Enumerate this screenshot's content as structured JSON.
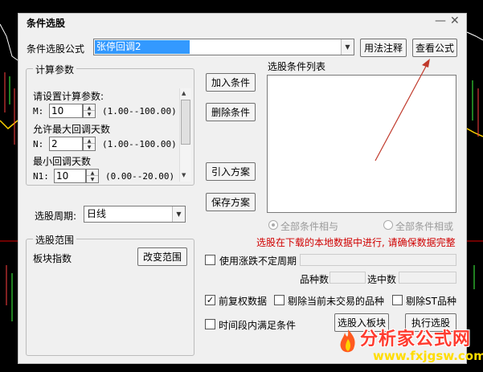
{
  "window": {
    "title": "条件选股"
  },
  "formula": {
    "label": "条件选股公式",
    "value": "张停回调2",
    "usage_button": "用法注释",
    "view_button": "查看公式"
  },
  "params": {
    "legend": "计算参数",
    "prompt": "请设置计算参数:",
    "items": [
      {
        "desc": "",
        "name": "M:",
        "value": "10",
        "range": "(1.00--100.00)"
      },
      {
        "desc": "允许最大回调天数",
        "name": "N:",
        "value": "2",
        "range": "(1.00--100.00)"
      },
      {
        "desc": "最小回调天数",
        "name": "N1:",
        "value": "10",
        "range": "(0.00--20.00)"
      }
    ]
  },
  "period": {
    "label": "选股周期:",
    "value": "日线"
  },
  "actions": {
    "add": "加入条件",
    "delete": "删除条件",
    "import": "引入方案",
    "save": "保存方案"
  },
  "condition_list": {
    "label": "选股条件列表"
  },
  "logic": {
    "all_and": "全部条件相与",
    "all_or": "全部条件相或"
  },
  "notice": "选股在下载的本地数据中进行, 请确保数据完整",
  "range": {
    "legend": "选股范围",
    "value": "板块指数",
    "change_button": "改变范围"
  },
  "options": {
    "uncertain_period": "使用涨跌不定周期",
    "count_label": "品种数",
    "selected_label": "选中数",
    "forward_adjust": "前复权数据",
    "exclude_non_trading": "剔除当前未交易的品种",
    "exclude_st": "剔除ST品种",
    "time_range": "时间段内满足条件",
    "to_block_button": "选股入板块",
    "execute_button": "执行选股"
  },
  "watermark": {
    "title": "分析家公式网",
    "url": "www.fxjgsw.com"
  },
  "colors": {
    "notice": "#d00000",
    "selection": "#3399ff",
    "arrow": "#c0392b"
  }
}
